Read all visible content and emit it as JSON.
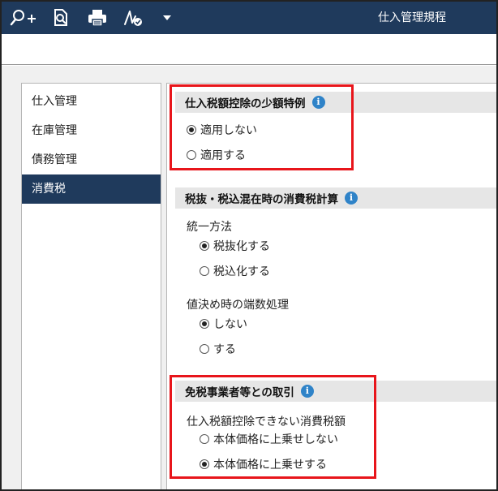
{
  "app": {
    "title": "仕入管理規程"
  },
  "toolbar": {
    "icons": [
      "zoom-in-icon",
      "search-page-icon",
      "print-icon",
      "signature-icon",
      "dropdown-arrow-icon"
    ]
  },
  "sidebar": {
    "items": [
      {
        "label": "仕入管理",
        "active": false
      },
      {
        "label": "在庫管理",
        "active": false
      },
      {
        "label": "債務管理",
        "active": false
      },
      {
        "label": "消費税",
        "active": true
      }
    ]
  },
  "sections": {
    "small_amount": {
      "title": "仕入税額控除の少額特例",
      "options": [
        {
          "label": "適用しない",
          "checked": true
        },
        {
          "label": "適用する",
          "checked": false
        }
      ]
    },
    "mixed_calc": {
      "title": "税抜・税込混在時の消費税計算",
      "unify_label": "統一方法",
      "unify_options": [
        {
          "label": "税抜化する",
          "checked": true
        },
        {
          "label": "税込化する",
          "checked": false
        }
      ],
      "rounding_label": "値決め時の端数処理",
      "rounding_options": [
        {
          "label": "しない",
          "checked": true
        },
        {
          "label": "する",
          "checked": false
        }
      ]
    },
    "exempt": {
      "title": "免税事業者等との取引",
      "sub_label": "仕入税額控除できない消費税額",
      "options": [
        {
          "label": "本体価格に上乗せしない",
          "checked": false
        },
        {
          "label": "本体価格に上乗せする",
          "checked": true
        }
      ]
    }
  },
  "colors": {
    "header_bg": "#1f3a5c",
    "highlight": "#e8151b",
    "info": "#2f83c8"
  }
}
